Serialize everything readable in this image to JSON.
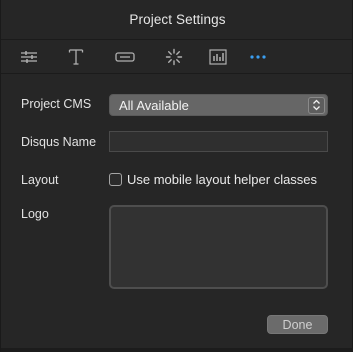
{
  "window": {
    "title": "Project Settings"
  },
  "toolbar": {
    "tabs": [
      {
        "icon": "sliders-icon",
        "selected": false
      },
      {
        "icon": "text-icon",
        "selected": false
      },
      {
        "icon": "button-icon",
        "selected": false
      },
      {
        "icon": "loading-spinner-icon",
        "selected": false
      },
      {
        "icon": "chart-icon",
        "selected": false
      },
      {
        "icon": "more-dots-icon",
        "selected": true
      }
    ],
    "selected_color": "#3b9ef0",
    "icon_color": "#b0b0b0"
  },
  "form": {
    "project_cms": {
      "label": "Project CMS",
      "value": "All Available"
    },
    "disqus_name": {
      "label": "Disqus Name",
      "value": "",
      "placeholder": ""
    },
    "layout": {
      "label": "Layout",
      "checkbox_label": "Use mobile layout helper classes",
      "checked": false
    },
    "logo": {
      "label": "Logo"
    }
  },
  "footer": {
    "done_label": "Done"
  }
}
